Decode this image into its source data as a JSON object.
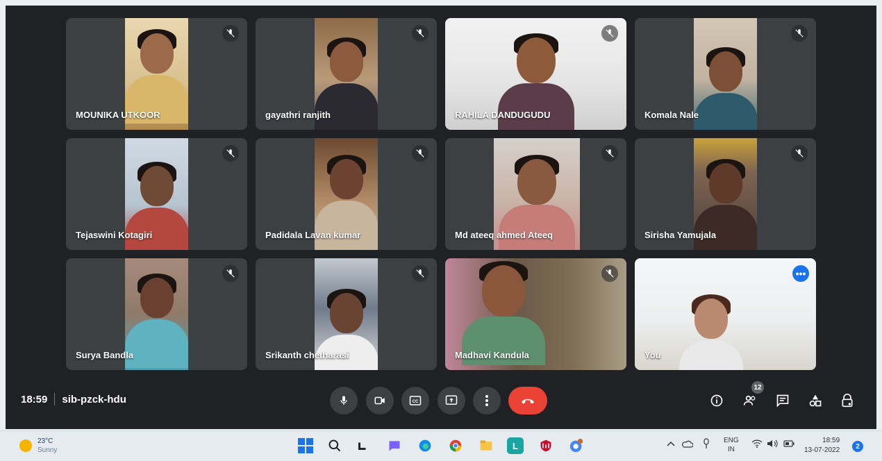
{
  "meeting": {
    "time": "18:59",
    "code": "sib-pzck-hdu",
    "participants_count": "12"
  },
  "tiles": [
    {
      "name": "MOUNIKA UTKOOR"
    },
    {
      "name": "gayathri ranjith"
    },
    {
      "name": "RAHILA DANDUGUDU"
    },
    {
      "name": "Komala Nale"
    },
    {
      "name": "Tejaswini Kotagiri"
    },
    {
      "name": "Padidala Lavan kumar"
    },
    {
      "name": "Md ateeq ahmed Ateeq"
    },
    {
      "name": "Sirisha Yamujala"
    },
    {
      "name": "Surya Bandla"
    },
    {
      "name": "Srikanth chetharasi"
    },
    {
      "name": "Madhavi Kandula"
    },
    {
      "name": "You"
    }
  ],
  "controls": {
    "icons": [
      "mic-icon",
      "camera-icon",
      "captions-icon",
      "present-icon",
      "more-options-icon",
      "end-call-icon"
    ],
    "right_icons": [
      "info-icon",
      "people-icon",
      "chat-icon",
      "activities-icon",
      "host-controls-icon"
    ]
  },
  "taskbar": {
    "weather_temp": "23°C",
    "weather_desc": "Sunny",
    "lang_line1": "ENG",
    "lang_line2": "IN",
    "clock_time": "18:59",
    "clock_date": "13-07-2022",
    "notifications": "2"
  },
  "colors": {
    "background": "#202124",
    "tile": "#3c4043",
    "end_call": "#ea4335",
    "accent": "#1a73e8",
    "self_outline": "#8ab4f8"
  }
}
